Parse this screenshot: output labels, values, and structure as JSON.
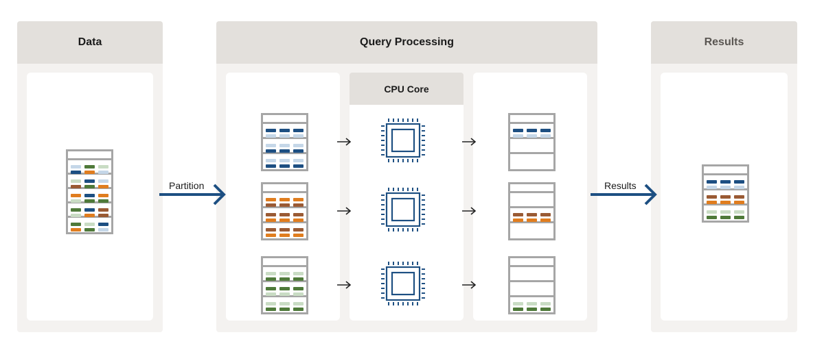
{
  "colors": {
    "blue": "#1d4f82",
    "blue_light": "#c5d7e8",
    "orange": "#e07d1f",
    "brown": "#9a5a34",
    "green": "#4f7a3a",
    "green_light": "#c9dcc4",
    "arrow": "#1d4f82",
    "header_bg": "#e3e0dc",
    "panel_bg": "#f4f2f0"
  },
  "panels": {
    "data": {
      "title": "Data"
    },
    "query": {
      "title": "Query Processing",
      "cpu_title": "CPU Core"
    },
    "results": {
      "title": "Results"
    }
  },
  "arrows": {
    "partition": "Partition",
    "results": "Results"
  },
  "icons": {
    "table": "table-icon",
    "cpu": "cpu-chip-icon",
    "arrow": "arrow-right-icon"
  },
  "tables": {
    "data_source": [
      [
        [
          "blue_light",
          "green",
          "green_light"
        ],
        [
          "blue",
          "orange",
          "blue_light"
        ]
      ],
      [
        [
          "green_light",
          "blue",
          "blue_light"
        ],
        [
          "brown",
          "green",
          "orange"
        ]
      ],
      [
        [
          "orange",
          "blue",
          "orange"
        ],
        [
          "green_light",
          "green",
          "green"
        ]
      ],
      [
        [
          "green",
          "blue",
          "brown"
        ],
        [
          "green_light",
          "orange",
          "brown"
        ]
      ],
      [
        [
          "green",
          "green_light",
          "blue"
        ],
        [
          "orange",
          "green",
          "blue_light"
        ]
      ]
    ],
    "partitions": [
      [
        [
          [
            "blue",
            "blue",
            "blue"
          ],
          [
            "blue_light",
            "blue_light",
            "blue_light"
          ]
        ],
        [
          [
            "blue_light",
            "blue_light",
            "blue_light"
          ],
          [
            "blue",
            "blue",
            "blue"
          ]
        ],
        [
          [
            "blue_light",
            "blue_light",
            "blue_light"
          ],
          [
            "blue",
            "blue",
            "blue"
          ]
        ]
      ],
      [
        [
          [
            "orange",
            "orange",
            "orange"
          ],
          [
            "brown",
            "brown",
            "brown"
          ]
        ],
        [
          [
            "brown",
            "brown",
            "brown"
          ],
          [
            "orange",
            "orange",
            "orange"
          ]
        ],
        [
          [
            "brown",
            "brown",
            "brown"
          ],
          [
            "orange",
            "orange",
            "orange"
          ]
        ]
      ],
      [
        [
          [
            "green_light",
            "green_light",
            "green_light"
          ],
          [
            "green",
            "green",
            "green"
          ]
        ],
        [
          [
            "green",
            "green",
            "green"
          ],
          [
            "green_light",
            "green_light",
            "green_light"
          ]
        ],
        [
          [
            "green_light",
            "green_light",
            "green_light"
          ],
          [
            "green",
            "green",
            "green"
          ]
        ]
      ]
    ],
    "outputs": [
      [
        [
          [
            "blue",
            "blue",
            "blue"
          ],
          [
            "blue_light",
            "blue_light",
            "blue_light"
          ]
        ],
        [],
        []
      ],
      [
        [],
        [
          [
            "brown",
            "brown",
            "brown"
          ],
          [
            "orange",
            "orange",
            "orange"
          ]
        ],
        []
      ],
      [
        [],
        [],
        [
          [
            "green_light",
            "green_light",
            "green_light"
          ],
          [
            "green",
            "green",
            "green"
          ]
        ]
      ]
    ],
    "final": [
      [
        [
          "blue",
          "blue",
          "blue"
        ],
        [
          "blue_light",
          "blue_light",
          "blue_light"
        ]
      ],
      [
        [
          "brown",
          "brown",
          "brown"
        ],
        [
          "orange",
          "orange",
          "orange"
        ]
      ],
      [
        [
          "green_light",
          "green_light",
          "green_light"
        ],
        [
          "green",
          "green",
          "green"
        ]
      ]
    ]
  }
}
